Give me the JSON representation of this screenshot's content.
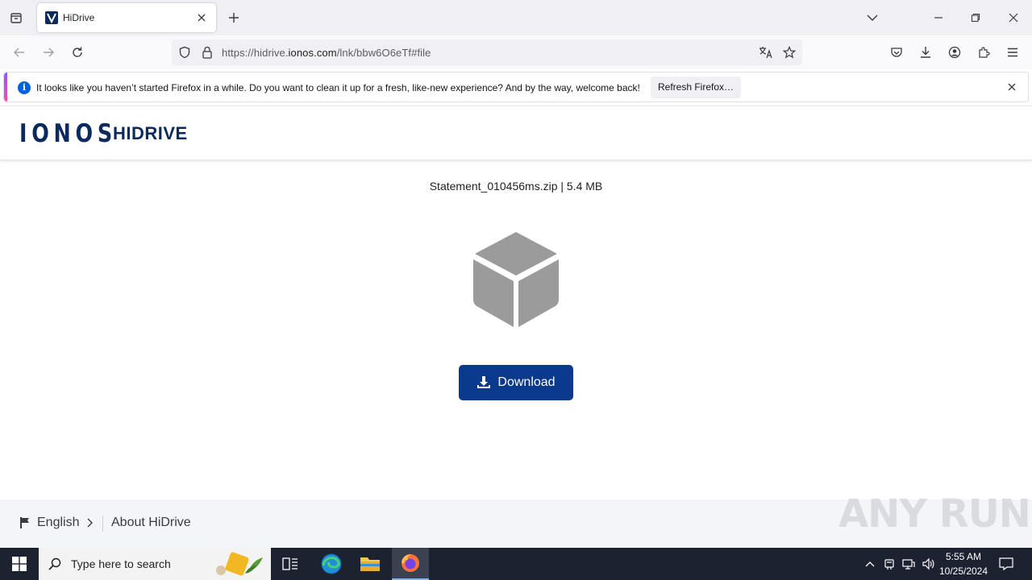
{
  "browser": {
    "tab_title": "HiDrive",
    "url_prefix": "https://hidrive.",
    "url_host": "ionos.com",
    "url_path": "/lnk/bbw6O6eTf#file"
  },
  "notification": {
    "message": "It looks like you haven’t started Firefox in a while. Do you want to clean it up for a fresh, like-new experience? And by the way, welcome back!",
    "button_label": "Refresh Firefox…"
  },
  "header": {
    "brand": "IONOS",
    "product": "HIDRIVE"
  },
  "main": {
    "file_info": "Statement_010456ms.zip | 5.4 MB",
    "download_label": "Download"
  },
  "footer": {
    "language": "English",
    "about": "About HiDrive"
  },
  "watermark": "ANY RUN",
  "taskbar": {
    "search_placeholder": "Type here to search",
    "time": "5:55 AM",
    "date": "10/25/2024"
  },
  "colors": {
    "brand_navy": "#0b2a5e",
    "download_button": "#0b3a8c",
    "cube_gray": "#9b9b9b"
  }
}
